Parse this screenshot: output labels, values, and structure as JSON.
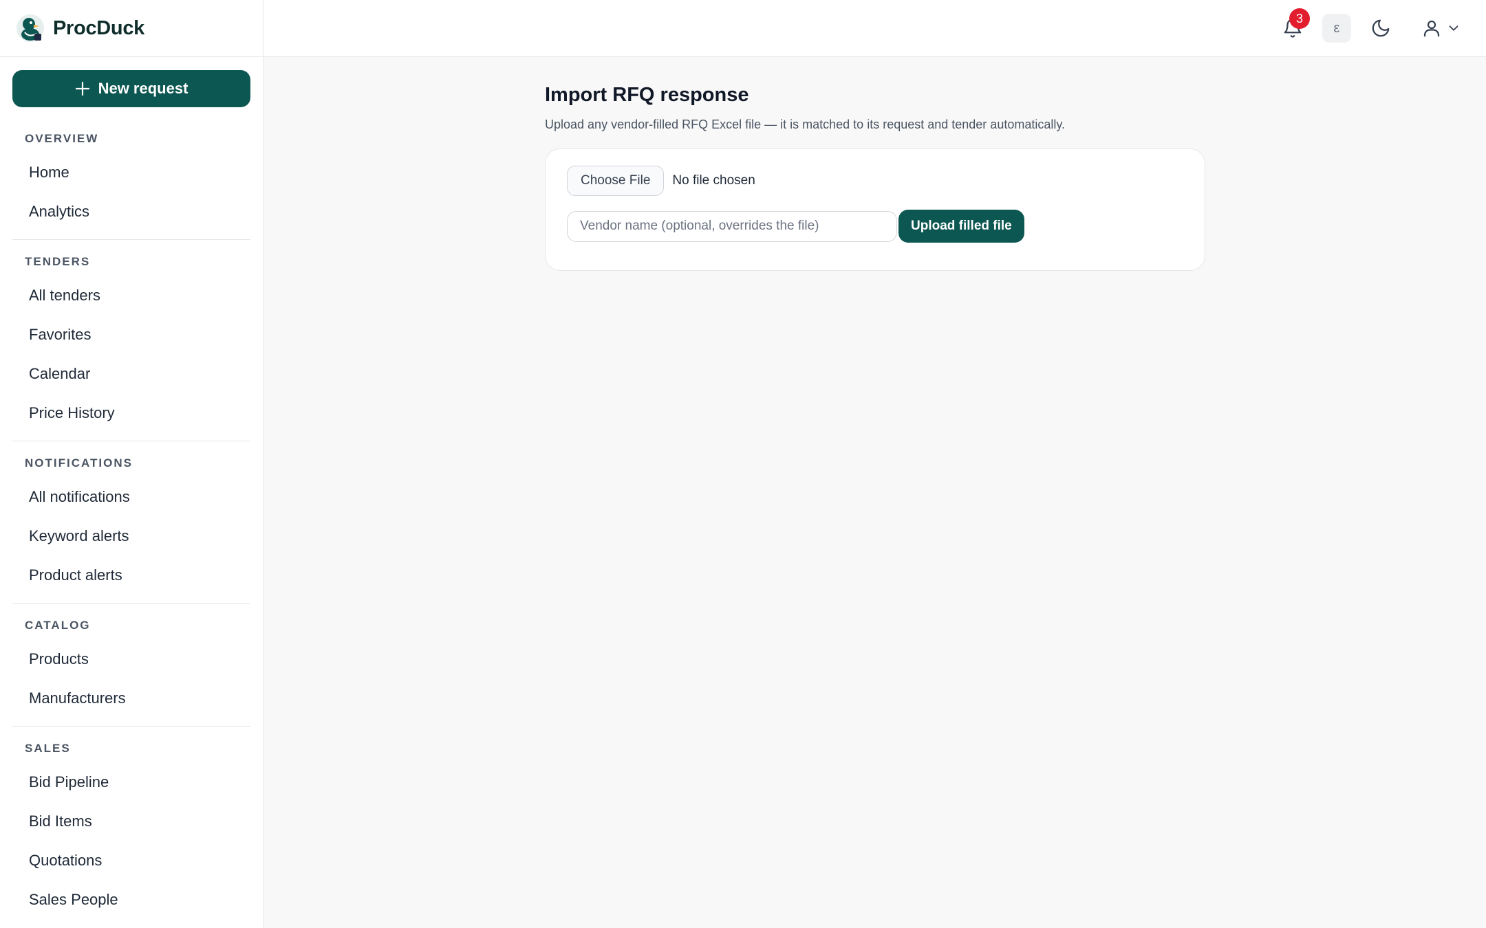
{
  "brand": {
    "name": "ProcDuck"
  },
  "sidebar": {
    "new_request_label": "New request",
    "sections": [
      {
        "title": "OVERVIEW",
        "items": [
          "Home",
          "Analytics"
        ]
      },
      {
        "title": "TENDERS",
        "items": [
          "All tenders",
          "Favorites",
          "Calendar",
          "Price History"
        ]
      },
      {
        "title": "NOTIFICATIONS",
        "items": [
          "All notifications",
          "Keyword alerts",
          "Product alerts"
        ]
      },
      {
        "title": "CATALOG",
        "items": [
          "Products",
          "Manufacturers"
        ]
      },
      {
        "title": "SALES",
        "items": [
          "Bid Pipeline",
          "Bid Items",
          "Quotations",
          "Sales People"
        ]
      }
    ]
  },
  "topbar": {
    "notification_count": "3",
    "language_label": "ε",
    "icons": [
      "bell-icon",
      "language-icon",
      "moon-icon",
      "user-icon",
      "chevron-down-icon"
    ]
  },
  "main": {
    "title": "Import RFQ response",
    "description": "Upload any vendor-filled RFQ Excel file — it is matched to its request and tender automatically.",
    "choose_file_label": "Choose File",
    "no_file_text": "No file chosen",
    "vendor_placeholder": "Vendor name (optional, overrides the file)",
    "upload_label": "Upload filled file"
  },
  "colors": {
    "accent": "#0d5752",
    "badge": "#e11d2e",
    "background": "#f8f8f8"
  }
}
